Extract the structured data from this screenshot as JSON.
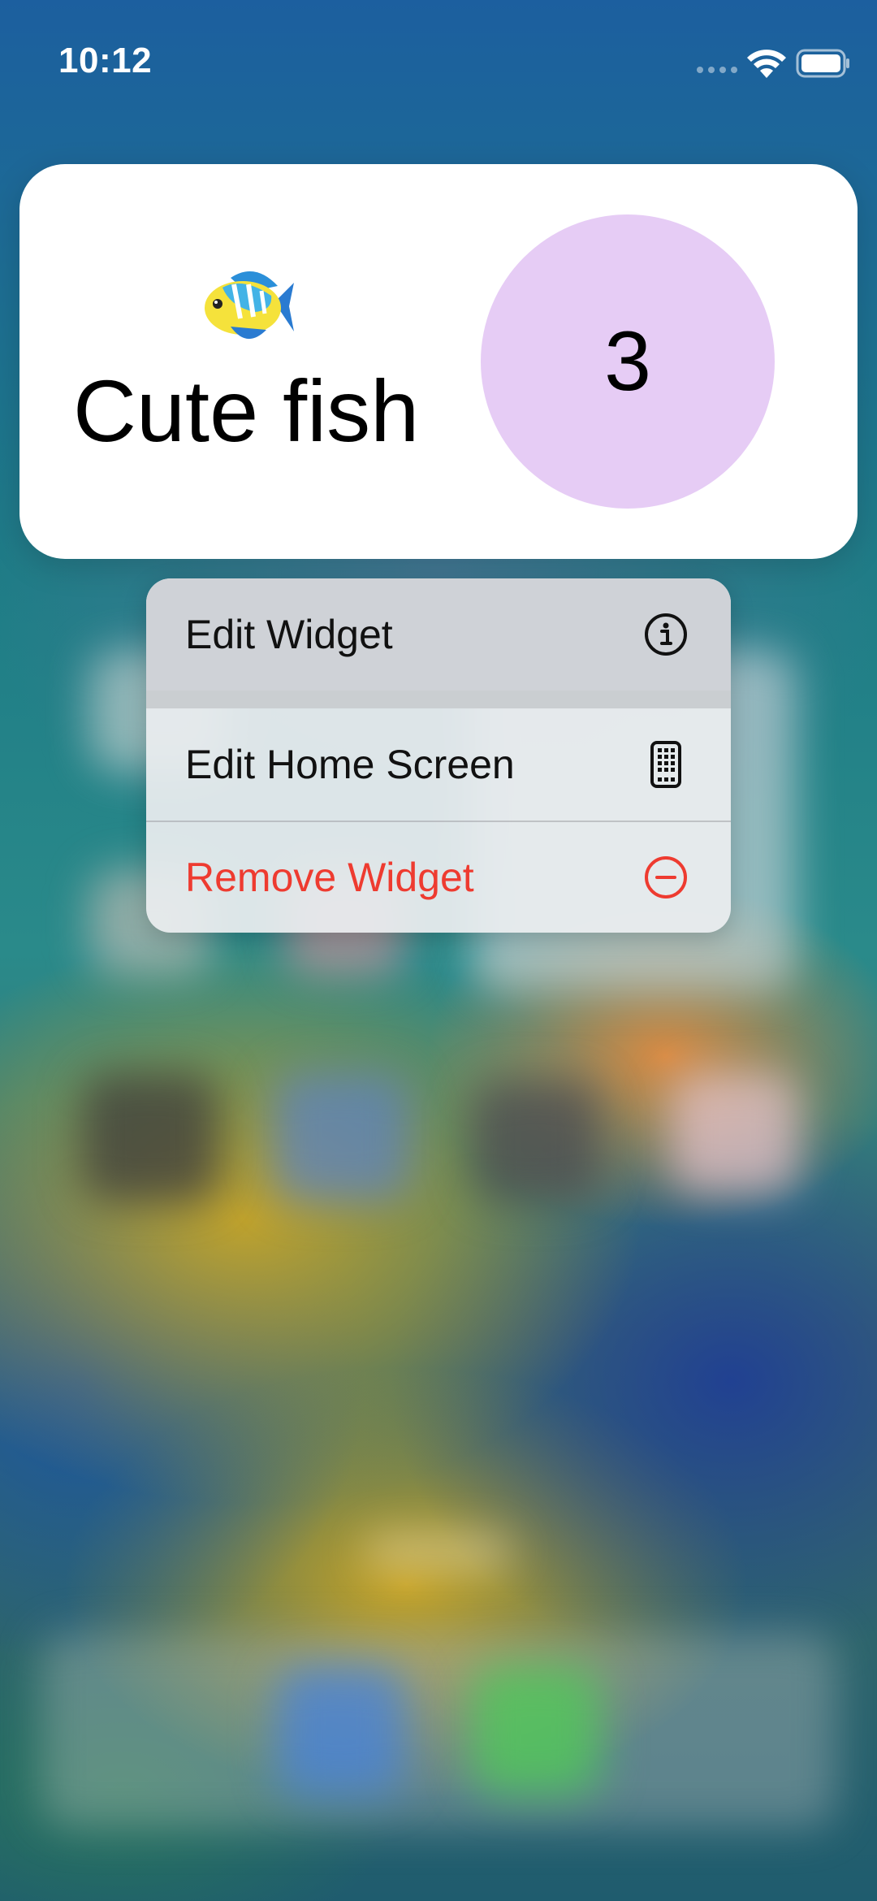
{
  "status_bar": {
    "time": "10:12",
    "wifi_icon": "wifi-icon",
    "battery_icon": "battery-full-icon"
  },
  "widget": {
    "emoji_icon": "tropical-fish-icon",
    "title": "Cute fish",
    "count": "3",
    "circle_color": "#e6ccf5"
  },
  "context_menu": {
    "items": [
      {
        "label": "Edit Widget",
        "icon": "info-circle-icon"
      },
      {
        "label": "Edit Home Screen",
        "icon": "phone-grid-icon"
      },
      {
        "label": "Remove Widget",
        "icon": "minus-circle-icon",
        "color": "#ee3b30"
      }
    ]
  }
}
